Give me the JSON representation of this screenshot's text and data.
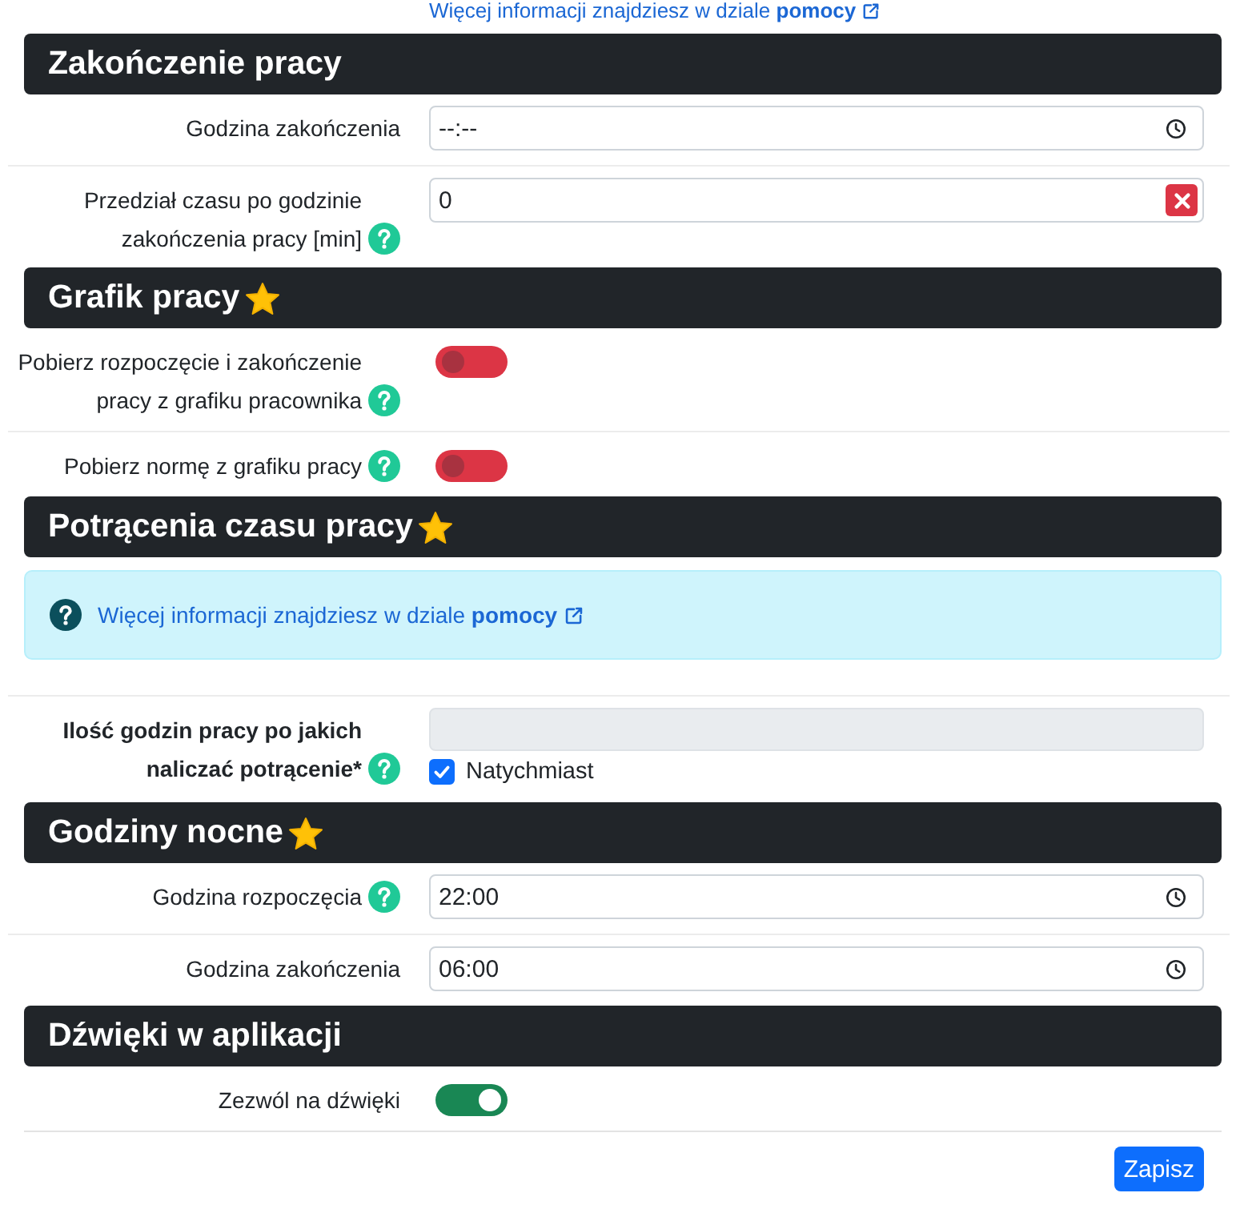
{
  "top_link": {
    "text": "Więcej informacji znajdziesz w dziale **pomocy**"
  },
  "sections": [
    {
      "title": "Zakończenie pracy",
      "starred": false,
      "rows": [
        {
          "kind": "time",
          "label": "Godzina zakończenia",
          "help": false,
          "placeholder": "--:--"
        },
        {
          "kind": "number",
          "label": "Przedział czasu po godzinie zakończenia pracy [min]",
          "help": true,
          "value": "0",
          "clearable": true
        }
      ]
    },
    {
      "title": "Grafik pracy",
      "starred": true,
      "rows": [
        {
          "kind": "switch",
          "label": "Pobierz rozpoczęcie i zakończenie pracy z grafiku pracownika",
          "help": true,
          "on": false
        },
        {
          "kind": "switch",
          "label": "Pobierz normę z grafiku pracy",
          "help": true,
          "on": false
        }
      ]
    },
    {
      "title": "Potrącenia czasu pracy",
      "starred": true,
      "rows": [
        {
          "kind": "alert",
          "text": "Więcej informacji znajdziesz w dziale **pomocy**"
        },
        {
          "kind": "threshold",
          "label": "Ilość godzin pracy po jakich naliczać potrącenie*",
          "help": true,
          "disabled": true,
          "checkbox": {
            "label": "Natychmiast",
            "checked": true
          }
        }
      ]
    },
    {
      "title": "Godziny nocne",
      "starred": true,
      "rows": [
        {
          "kind": "time",
          "label": "Godzina rozpoczęcia",
          "help": true,
          "value": "22:00"
        },
        {
          "kind": "time",
          "label": "Godzina zakończenia",
          "help": false,
          "value": "06:00"
        }
      ]
    },
    {
      "title": "Dźwięki w aplikacji",
      "starred": false,
      "rows": [
        {
          "kind": "switch",
          "label": "Zezwól na dźwięki",
          "help": false,
          "on": true
        }
      ]
    }
  ],
  "save_button": "Zapisz"
}
